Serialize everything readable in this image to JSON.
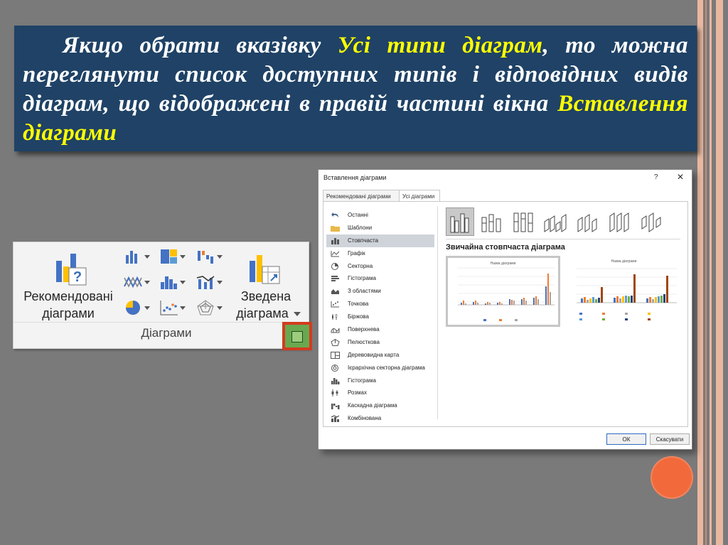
{
  "banner": {
    "p1": "Якщо обрати вказівку ",
    "h1": "Усі типи діаграм",
    "p2": ", то можна переглянути список доступних типів і відповідних видів діаграм, що відображені в правій частині вікна ",
    "h2": "Вставлення діаграми"
  },
  "ribbon": {
    "recommended_line1": "Рекомендовані",
    "recommended_line2": "діаграми",
    "pivot_line1": "Зведена",
    "pivot_line2": "діаграма",
    "group_label": "Діаграми"
  },
  "dialog": {
    "title": "Вставлення діаграми",
    "help": "?",
    "close": "✕",
    "tabs": [
      "Рекомендовані діаграми",
      "Усі діаграми"
    ],
    "types": [
      "Останні",
      "Шаблони",
      "Стовпчаста",
      "Графік",
      "Секторна",
      "Гістограма",
      "З областями",
      "Точкова",
      "Біржова",
      "Поверхнева",
      "Пелюсткова",
      "Деревовидна карта",
      "Ієрархічна секторна діаграма",
      "Гістограма",
      "Розмах",
      "Каскадна діаграма",
      "Комбінована"
    ],
    "selected_type": "Стовпчаста",
    "variant_title": "Звичайна стовпчаста діаграма",
    "preview_title": "Назва діаграми",
    "ok": "ОК",
    "cancel": "Скасувати"
  },
  "colors": {
    "banner_bg": "#1f4266",
    "highlight": "#ffff00",
    "accent_red": "#d33b1f",
    "series": [
      "#4472c4",
      "#ed7d31",
      "#a5a5a5",
      "#ffc000",
      "#5b9bd5",
      "#70ad47",
      "#264478",
      "#9e480e"
    ]
  },
  "icons": {
    "recommended": "recommended-charts-icon",
    "pivot": "pivot-chart-icon",
    "launcher": "dialog-launcher-icon"
  }
}
